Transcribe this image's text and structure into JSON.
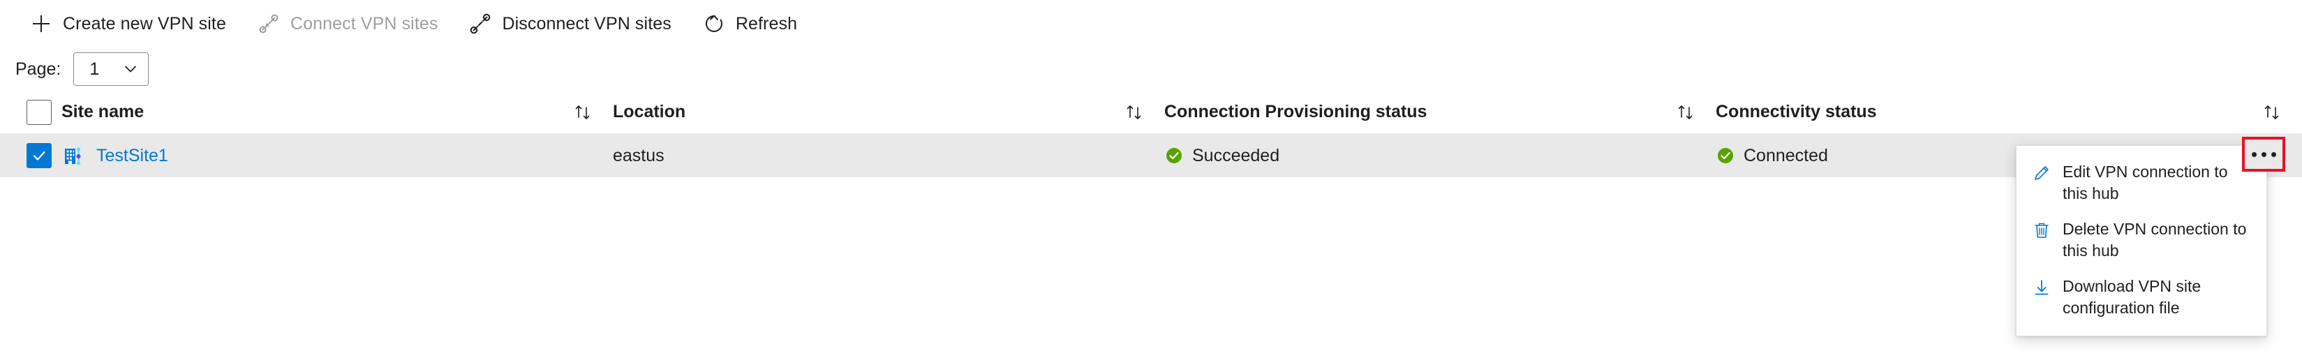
{
  "toolbar": {
    "buttons": [
      {
        "label": "Create new VPN site",
        "icon": "plus-icon",
        "disabled": false
      },
      {
        "label": "Connect VPN sites",
        "icon": "connect-plug-icon",
        "disabled": true
      },
      {
        "label": "Disconnect VPN sites",
        "icon": "disconnect-plug-icon",
        "disabled": false
      },
      {
        "label": "Refresh",
        "icon": "refresh-icon",
        "disabled": false
      }
    ]
  },
  "pager": {
    "label": "Page:",
    "value": "1",
    "options": [
      "1"
    ],
    "chevron_icon": "chevron-down-icon"
  },
  "table": {
    "columns": [
      {
        "key": "site_name",
        "label": "Site name",
        "sort_icon": "sort-updown-icon"
      },
      {
        "key": "location",
        "label": "Location",
        "sort_icon": "sort-updown-icon"
      },
      {
        "key": "provisioning",
        "label": "Connection Provisioning status",
        "sort_icon": "sort-updown-icon"
      },
      {
        "key": "connectivity",
        "label": "Connectivity status",
        "sort_icon": "sort-updown-icon"
      }
    ],
    "header_checkbox": {
      "checked": false,
      "icon": "checkbox-icon"
    },
    "rows": [
      {
        "selected": true,
        "row_icon": "vpn-site-icon",
        "site_name": "TestSite1",
        "location": "eastus",
        "provisioning": "Succeeded",
        "provisioning_icon": "success-check-icon",
        "connectivity": "Connected",
        "connectivity_icon": "success-check-icon",
        "more_icon": "ellipsis-icon"
      }
    ]
  },
  "context_menu": {
    "items": [
      {
        "label": "Edit VPN connection to this hub",
        "icon": "pencil-edit-icon"
      },
      {
        "label": "Delete VPN connection to this hub",
        "icon": "trash-delete-icon"
      },
      {
        "label": "Download VPN site configuration file",
        "icon": "download-arrow-icon"
      }
    ]
  },
  "colors": {
    "accent": "#0078d4",
    "success": "#57a300",
    "highlight_border": "#e81123",
    "row_selected_bg": "#e9e9e9"
  }
}
